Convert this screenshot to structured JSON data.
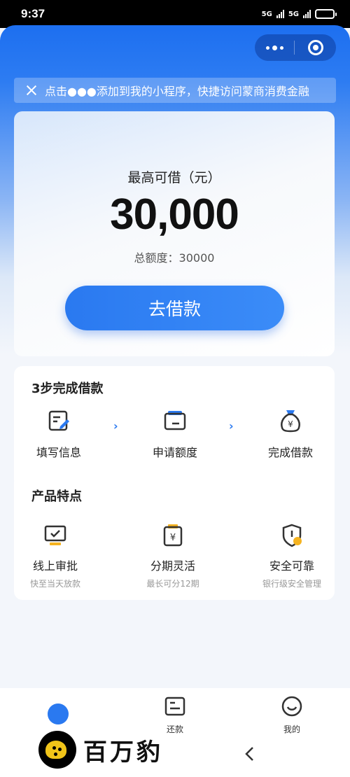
{
  "status_bar": {
    "time": "9:37",
    "network": "5G"
  },
  "capsule": {
    "more_icon": "three-dots-icon",
    "close_icon": "target-circle-icon"
  },
  "tip": {
    "text": "点击●●●添加到我的小程序，快捷访问蒙商消费金融"
  },
  "hero": {
    "label": "最高可借（元）",
    "amount": "30,000",
    "quota": "总额度：30000",
    "cta": "去借款"
  },
  "steps": {
    "title": "3步完成借款",
    "items": [
      {
        "label": "填写信息",
        "icon": "edit-form-icon"
      },
      {
        "label": "申请额度",
        "icon": "wallet-card-icon"
      },
      {
        "label": "完成借款",
        "icon": "money-bag-icon"
      }
    ]
  },
  "features": {
    "title": "产品特点",
    "items": [
      {
        "label": "线上审批",
        "sub": "快至当天放款",
        "icon": "monitor-check-icon"
      },
      {
        "label": "分期灵活",
        "sub": "最长可分12期",
        "icon": "yen-card-icon"
      },
      {
        "label": "安全可靠",
        "sub": "银行级安全管理",
        "icon": "shield-icon"
      }
    ]
  },
  "tabbar": {
    "items": [
      {
        "label": "",
        "icon": "home-dot-icon"
      },
      {
        "label": "还款",
        "icon": "repay-card-icon"
      },
      {
        "label": "我的",
        "icon": "smile-face-icon"
      }
    ]
  },
  "watermark": {
    "text": "百万豹"
  },
  "colors": {
    "primary": "#2a79f0",
    "accent": "#f5b320"
  }
}
